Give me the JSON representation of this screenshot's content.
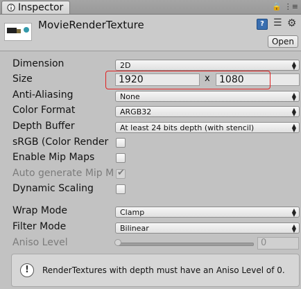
{
  "tab": {
    "label": "Inspector"
  },
  "header": {
    "asset_name": "MovieRenderTexture",
    "open_label": "Open",
    "help_glyph": "?"
  },
  "properties": {
    "dimension": {
      "label": "Dimension",
      "value": "2D"
    },
    "size": {
      "label": "Size",
      "width": "1920",
      "separator": "x",
      "height": "1080"
    },
    "anti_aliasing": {
      "label": "Anti-Aliasing",
      "value": "None"
    },
    "color_format": {
      "label": "Color Format",
      "value": "ARGB32"
    },
    "depth_buffer": {
      "label": "Depth Buffer",
      "value": "At least 24 bits depth (with stencil)"
    },
    "srgb": {
      "label": "sRGB (Color Render",
      "checked": false
    },
    "enable_mip_maps": {
      "label": "Enable Mip Maps",
      "checked": false
    },
    "auto_generate_mip": {
      "label": "Auto generate Mip M",
      "checked": true,
      "disabled": true
    },
    "dynamic_scaling": {
      "label": "Dynamic Scaling",
      "checked": false
    },
    "wrap_mode": {
      "label": "Wrap Mode",
      "value": "Clamp"
    },
    "filter_mode": {
      "label": "Filter Mode",
      "value": "Bilinear"
    },
    "aniso_level": {
      "label": "Aniso Level",
      "value": "0",
      "slider_fraction": 0
    }
  },
  "help_box": {
    "message": "RenderTextures with depth must have an Aniso Level of 0."
  },
  "icons": {
    "tab": "inspector-icon",
    "lock": "lock-icon",
    "menu": "menu-icon",
    "help": "help-icon",
    "presets": "presets-icon",
    "settings": "gear-icon",
    "info": "info-icon"
  },
  "colors": {
    "highlight": "#e02020",
    "help_icon": "#3a6fb0",
    "background": "#c2c2c2"
  }
}
